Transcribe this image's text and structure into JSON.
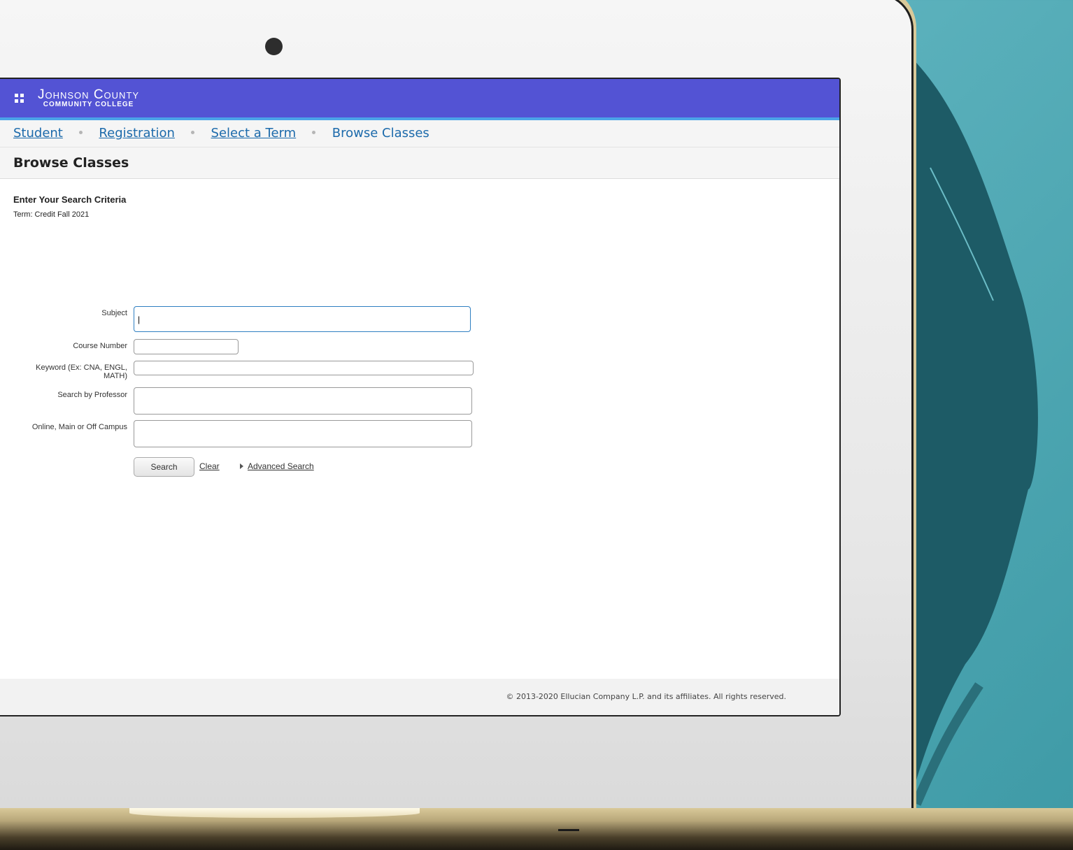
{
  "header": {
    "logo_main": "Johnson County",
    "logo_sub": "COMMUNITY COLLEGE"
  },
  "breadcrumb": {
    "items": [
      "Student",
      "Registration",
      "Select a Term"
    ],
    "current": "Browse Classes"
  },
  "page_title": "Browse Classes",
  "form": {
    "heading": "Enter Your Search Criteria",
    "term": "Term: Credit Fall 2021",
    "fields": {
      "subject": {
        "label": "Subject",
        "value": "|"
      },
      "course_number": {
        "label": "Course Number",
        "value": ""
      },
      "keyword": {
        "label": "Keyword (Ex: CNA, ENGL, MATH)",
        "value": ""
      },
      "professor": {
        "label": "Search by Professor",
        "value": ""
      },
      "campus": {
        "label": "Online, Main or Off Campus",
        "value": ""
      }
    },
    "search_button": "Search",
    "clear_link": "Clear",
    "advanced_link": "Advanced Search"
  },
  "footer": {
    "copyright": "© 2013-2020 Ellucian Company L.P. and its affiliates. All rights reserved."
  },
  "colors": {
    "header": "#5353d4",
    "header_border": "#4aa3e8",
    "link": "#1c6aab",
    "background": "#3a9aa8"
  }
}
